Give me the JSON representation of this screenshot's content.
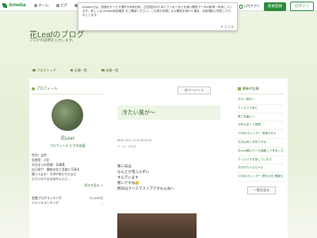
{
  "topbar": {
    "logo": "Ameba",
    "nav": [
      "ホーム",
      "ピグ",
      "アメブロ"
    ],
    "app_link": "入門アプリ",
    "register": "新規登録",
    "login": "ログイン"
  },
  "cookie": {
    "text": "Amebaでは、快適なサービス提供や利用分析、広告配信のためにクッキーなどを使い閲覧データの取得・利用しています。詳しくは Ameba利用規約 をご確認ください。この表示を閉じるか閲覧を続けた場合、利用規約に同意したものとします。",
    "close": "とじる"
  },
  "header": {
    "title": "花Leafのブログ",
    "description": "ブログの説明を入力します。"
  },
  "menu": [
    "ブログトップ",
    "記事一覧",
    "画像一覧"
  ],
  "left": {
    "profile_heading": "プロフィール",
    "nickname": "花Leaf",
    "links": "プロフィール  ピグの部屋",
    "info": [
      "性別：女性",
      "血液型：O型",
      "お住まいの地域：兵庫県",
      "自己紹介：趣味の花と音楽と写真を",
      "撮ってます！子供や孫たちもまだ",
      "小さいのでおばあちゃんと..."
    ],
    "more": "続きを見る >",
    "ranking": [
      {
        "label": "金融ブログランキング",
        "value": "33,489位"
      },
      {
        "label": "ジャンルランキング",
        "value": "..."
      }
    ]
  },
  "center": {
    "next": "次ページへ >",
    "entry_title": "冷たい風が〜",
    "meta": "NEW! 2022-12-20 00:00:00",
    "theme": "テーマ：ブログ",
    "body": [
      "寒い日は",
      "なんとか雪ふらずに",
      "すんでいます",
      "寒いですね🙂",
      "明日はクリスマスイブですもんね〜"
    ]
  },
  "right": {
    "recent_heading": "最新の記事",
    "recent": [
      "冷たい風が〜",
      "クリスマス前に",
      "寒さ本番に〜",
      "今年もあと３週間",
      "12月のカレンダー 音楽の日々",
      "今日は良い天気ですね",
      "花Leaf朝ふり〜も撮影して来ました",
      "クリスマスを探しています",
      "今日のちゃんちゃん",
      "12月のカレンダー 晴れの日 素敵な"
    ],
    "list_button": "一覧を見る"
  }
}
